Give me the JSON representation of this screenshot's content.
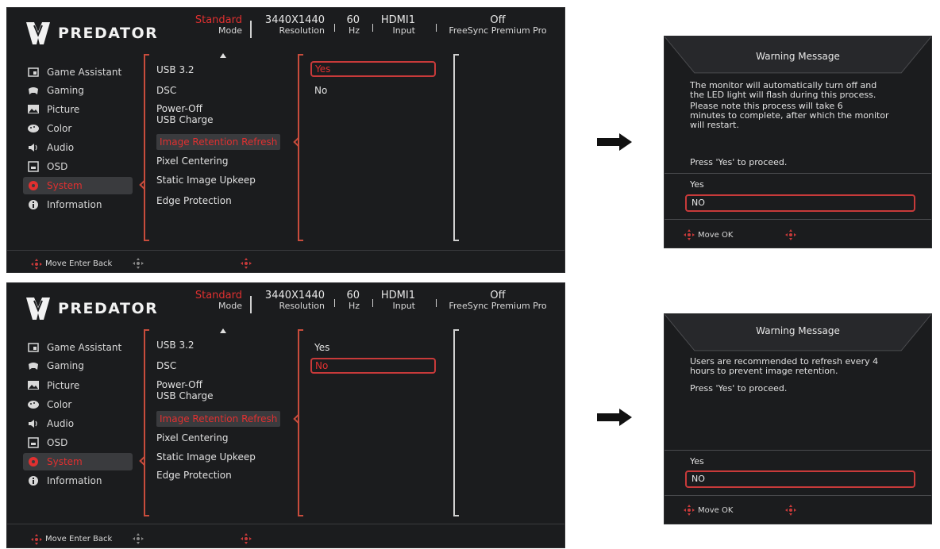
{
  "colors": {
    "accent_red": "#e03030",
    "panel_bg": "#1b1c1e"
  },
  "brand": {
    "logo_text": "PREDATOR"
  },
  "status": {
    "mode_value": "Standard",
    "mode_label": "Mode",
    "resolution_value": "3440X1440",
    "resolution_label": "Resolution",
    "hz_value": "60",
    "hz_label": "Hz",
    "input_value": "HDMI1",
    "input_label": "Input",
    "freesync_value": "Off",
    "freesync_label": "FreeSync Premium Pro"
  },
  "menu": [
    {
      "label": "Game Assistant",
      "icon": "game-assistant-icon"
    },
    {
      "label": "Gaming",
      "icon": "gamepad-icon"
    },
    {
      "label": "Picture",
      "icon": "picture-icon"
    },
    {
      "label": "Color",
      "icon": "palette-icon"
    },
    {
      "label": "Audio",
      "icon": "speaker-icon"
    },
    {
      "label": "OSD",
      "icon": "osd-icon"
    },
    {
      "label": "System",
      "icon": "gear-icon"
    },
    {
      "label": "Information",
      "icon": "info-icon"
    }
  ],
  "submenu": {
    "usb": "USB 3.2",
    "dsc": "DSC",
    "poweroff_line1": "Power-Off",
    "poweroff_line2": "USB Charge",
    "retention": "Image Retention Refresh",
    "pixel": "Pixel Centering",
    "static": "Static Image Upkeep",
    "edge": "Edge Protection"
  },
  "options": {
    "yes": "Yes",
    "no": "No"
  },
  "footer": {
    "label": "Move Enter Back"
  },
  "warning1": {
    "title": "Warning Message",
    "line1": "The monitor will automatically turn off and",
    "line2": "the LED light will flash during this process.",
    "line3": "Please note this process will take 6",
    "line4": "minutes to complete, after which the monitor",
    "line5": "will restart.",
    "proceed": "Press 'Yes' to proceed.",
    "yes": "Yes",
    "no": "NO",
    "footer": "Move OK"
  },
  "warning2": {
    "title": "Warning Message",
    "line1": "Users are recommended to refresh every 4",
    "line2": "hours to prevent image retention.",
    "proceed": "Press 'Yes' to proceed.",
    "yes": "Yes",
    "no": "NO",
    "footer": "Move OK"
  }
}
